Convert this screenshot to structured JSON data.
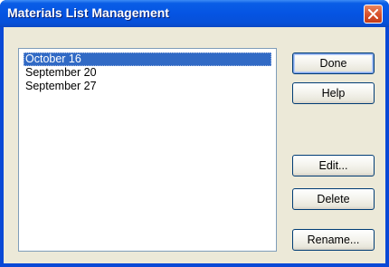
{
  "window": {
    "title": "Materials List Management"
  },
  "list": {
    "items": [
      {
        "label": "October 16",
        "selected": true
      },
      {
        "label": "September 20",
        "selected": false
      },
      {
        "label": "September 27",
        "selected": false
      }
    ]
  },
  "buttons": {
    "done": "Done",
    "help": "Help",
    "edit": "Edit...",
    "delete": "Delete",
    "rename": "Rename..."
  },
  "icons": {
    "close": "close-icon"
  },
  "colors": {
    "titlebar": "#0554e3",
    "selection": "#316ac5",
    "dialog_bg": "#ece9d8",
    "close_button": "#d7502b"
  }
}
